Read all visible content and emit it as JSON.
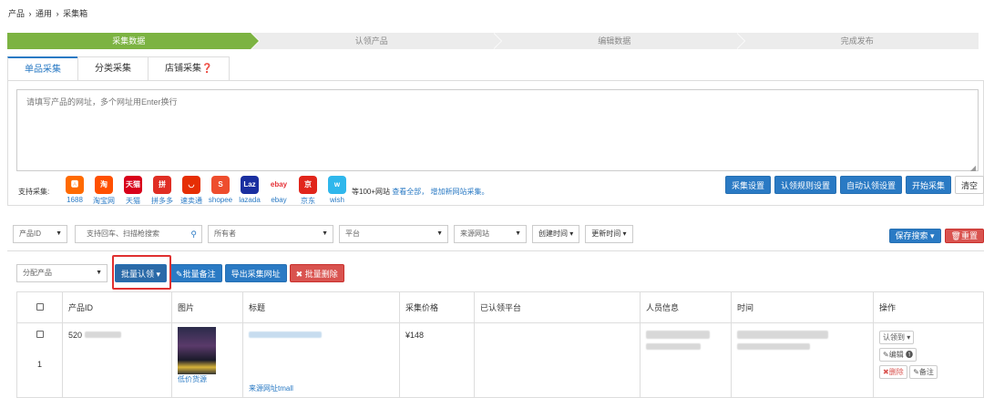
{
  "breadcrumb": [
    "产品",
    "通用",
    "采集箱"
  ],
  "breadcrumb_sep": "›",
  "steps": [
    "采集数据",
    "认领产品",
    "编辑数据",
    "完成发布"
  ],
  "tabs": [
    "单品采集",
    "分类采集",
    "店铺采集❓"
  ],
  "url_input": {
    "placeholder": "请填写产品的网址，多个网址用Enter换行"
  },
  "support_label": "支持采集:",
  "platforms": [
    {
      "name": "1688",
      "color": "#ff6a00",
      "glyph": "🅰"
    },
    {
      "name": "淘宝网",
      "color": "#ff5000",
      "glyph": "淘"
    },
    {
      "name": "天猫",
      "color": "#d8001a",
      "glyph": "天猫"
    },
    {
      "name": "拼多多",
      "color": "#e02e24",
      "glyph": "拼"
    },
    {
      "name": "速卖通",
      "color": "#e62e04",
      "glyph": "◡"
    },
    {
      "name": "shopee",
      "color": "#ee4d2d",
      "glyph": "S"
    },
    {
      "name": "lazada",
      "color": "#1a2fa0",
      "glyph": "Laz"
    },
    {
      "name": "ebay",
      "color": "#ffffff",
      "glyph": "ebay"
    },
    {
      "name": "京东",
      "color": "#e1251b",
      "glyph": "京"
    },
    {
      "name": "wish",
      "color": "#2fb7ec",
      "glyph": "w"
    }
  ],
  "more_sites": {
    "text": "等100+网站",
    "view_all": "查看全部，",
    "add_new": "增加新网站采集。"
  },
  "top_buttons": [
    "采集设置",
    "认领规则设置",
    "自动认领设置",
    "开始采集",
    "清空"
  ],
  "filters": {
    "product_id": "产品ID",
    "search_placeholder": "支持回车、扫描枪搜索",
    "owner": "所有者",
    "platform": "平台",
    "source": "来源网站",
    "created": "创建时间",
    "updated": "更新时间"
  },
  "save_search": "保存搜索",
  "reset": "重置",
  "assign": "分配产品",
  "actions": [
    "批量认领",
    "批量备注",
    "导出采集网址",
    "批量删除"
  ],
  "table": {
    "headers": [
      "",
      "产品ID",
      "图片",
      "标题",
      "采集价格",
      "已认领平台",
      "人员信息",
      "时间",
      "操作"
    ],
    "row": {
      "index": "1",
      "id": "520",
      "price": "¥148",
      "img_link": "低价货源",
      "source_link": "来源网址tmall",
      "claim": "认领到",
      "edit": "编辑",
      "delete": "删除",
      "note": "备注"
    }
  }
}
